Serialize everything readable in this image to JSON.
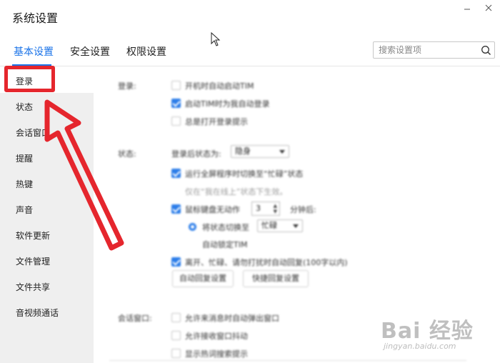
{
  "window": {
    "title": "系统设置"
  },
  "tabs": [
    {
      "label": "基本设置"
    },
    {
      "label": "安全设置"
    },
    {
      "label": "权限设置"
    }
  ],
  "search": {
    "placeholder": "搜索设置项"
  },
  "sidebar": {
    "items": [
      {
        "label": "登录"
      },
      {
        "label": "状态"
      },
      {
        "label": "会话窗口"
      },
      {
        "label": "提醒"
      },
      {
        "label": "热键"
      },
      {
        "label": "声音"
      },
      {
        "label": "软件更新"
      },
      {
        "label": "文件管理"
      },
      {
        "label": "文件共享"
      },
      {
        "label": "音视频通话"
      }
    ]
  },
  "content": {
    "login": {
      "label": "登录:",
      "options": [
        {
          "text": "开机时自动启动TIM",
          "checked": false
        },
        {
          "text": "启动TIM时为我自动登录",
          "checked": true
        },
        {
          "text": "总是打开登录提示",
          "checked": false
        }
      ]
    },
    "status": {
      "label": "状态:",
      "after_login_label": "登录后状态为:",
      "after_login_value": "隐身",
      "fullscreen_option": {
        "text": "运行全屏程序时切换至“忙碌”状态",
        "checked": true
      },
      "fullscreen_note": "仅在“我在线上”状态下生效。",
      "idle_option": {
        "text": "鼠标键盘无动作",
        "checked": true
      },
      "idle_minutes": "3",
      "idle_unit": "分钟后:",
      "radio_switch": {
        "text": "将状态切换至",
        "value": "忙碌"
      },
      "radio_lock": {
        "text": "自动锁定TIM"
      },
      "auto_reply": {
        "text": "离开、忙碌、请勿打扰时自动回复(100字以内)",
        "checked": true
      },
      "buttons": {
        "auto_reply_settings": "自动回复设置",
        "quick_reply_settings": "快捷回复设置"
      }
    },
    "chat_window": {
      "label": "会话窗口:",
      "options": [
        {
          "text": "允许来消息时自动弹出窗口",
          "checked": false
        },
        {
          "text": "允许接收窗口抖动",
          "checked": false
        },
        {
          "text": "显示热词搜索提示",
          "checked": false
        }
      ]
    }
  },
  "watermark": {
    "main": "Bai 经验",
    "sub": "jingyan.baidu.com"
  },
  "colors": {
    "accent": "#1a73e8",
    "annotation": "#e5262d",
    "sidebar_bg": "#efefef"
  }
}
